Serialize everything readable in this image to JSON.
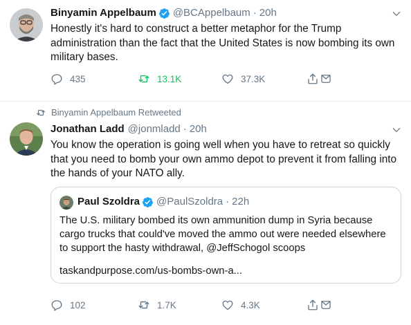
{
  "tweet1": {
    "name": "Binyamin Appelbaum",
    "handle": "@BCAppelbaum",
    "time": "20h",
    "text": "Honestly it's hard to construct a better metaphor for the Trump administration than the fact that the United States is now bombing its own military bases.",
    "replies": "435",
    "retweets": "13.1K",
    "likes": "37.3K",
    "retweeted_by_user": true
  },
  "tweet2": {
    "retweet_label": "Binyamin Appelbaum Retweeted",
    "name": "Jonathan Ladd",
    "handle": "@jonmladd",
    "time": "20h",
    "text": "You know the operation is going well when you have to retreat so quickly that you need to bomb your own ammo depot to prevent it from falling into the hands of your NATO ally.",
    "replies": "102",
    "retweets": "1.7K",
    "likes": "4.3K",
    "quote": {
      "name": "Paul Szoldra",
      "handle": "@PaulSzoldra",
      "time": "22h",
      "text": "The U.S. military bombed its own ammunition dump in Syria because cargo trucks that could've moved the ammo out were needed elsewhere to support the hasty withdrawal, @JeffSchogol scoops",
      "link": "taskandpurpose.com/us-bombs-own-a..."
    }
  },
  "dot": "·",
  "colors": {
    "primary_text": "#14171a",
    "secondary_text": "#657786",
    "verified_blue": "#1da1f2",
    "retweet_active_green": "#17bf63",
    "divider": "#e6ecf0",
    "quote_border": "#ccd6dd"
  },
  "icons": [
    "verified-badge-icon",
    "chevron-down-icon",
    "reply-icon",
    "retweet-icon",
    "like-icon",
    "share-icon",
    "dm-icon"
  ]
}
